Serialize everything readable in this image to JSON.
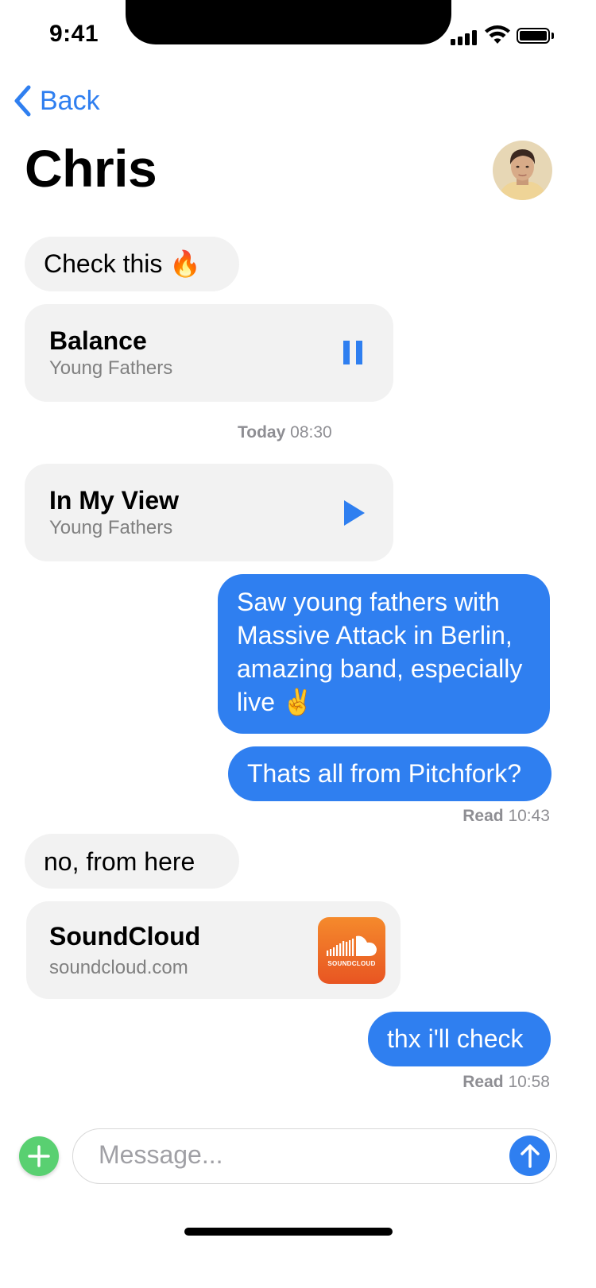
{
  "status_bar": {
    "time": "9:41"
  },
  "header": {
    "back_label": "Back",
    "title": "Chris"
  },
  "messages": {
    "m1": "Check this 🔥",
    "track1": {
      "title": "Balance",
      "artist": "Young Fathers",
      "state": "paused"
    },
    "ts1": {
      "day": "Today",
      "time": "08:30"
    },
    "track2": {
      "title": "In My View",
      "artist": "Young Fathers",
      "state": "stopped"
    },
    "m2": "Saw young fathers with Massive Attack in Berlin, amazing band, especially live ✌️",
    "m3": "Thats all from Pitchfork?",
    "read1": {
      "label": "Read",
      "time": "10:43"
    },
    "m4": "no, from here",
    "link": {
      "title": "SoundCloud",
      "domain": "soundcloud.com",
      "logo_text": "SOUNDCLOUD"
    },
    "m5": "thx i'll check",
    "read2": {
      "label": "Read",
      "time": "10:58"
    }
  },
  "composer": {
    "placeholder": "Message..."
  },
  "colors": {
    "accent": "#2f7ff0",
    "incoming_bubble": "#f2f2f2",
    "plus_button": "#59d071",
    "soundcloud": "#f26f23"
  },
  "icons": [
    "back-chevron-icon",
    "pause-icon",
    "play-icon",
    "plus-icon",
    "send-arrow-icon",
    "soundcloud-logo-icon"
  ]
}
